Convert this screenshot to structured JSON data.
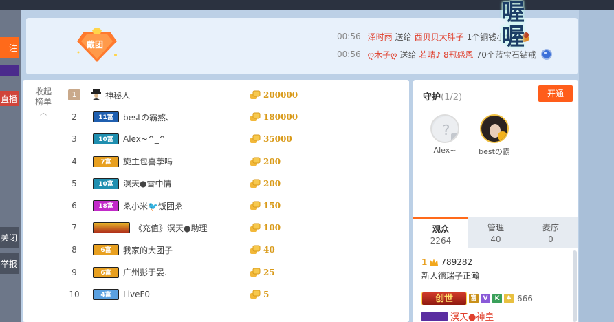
{
  "left_strip": {
    "orange_label": "注",
    "red_label": "直播",
    "dark1_label": "关闭",
    "dark2_label": "举报"
  },
  "banner": {
    "badge_label": "戴团",
    "feed": [
      {
        "time": "00:56",
        "sender": "泽时雨",
        "action": "送给",
        "receiver": "西贝贝大胖子",
        "gift": "1个铜钱小伙"
      },
      {
        "time": "00:56",
        "sender": "ღ木子ღ",
        "action": "送给",
        "receiver": "若晴♪ 8冠感恩",
        "gift": "70个蓝宝石钻戒"
      }
    ],
    "overlay_text": "喔喔"
  },
  "rank": {
    "collapse_label": "收起榜单",
    "collapse_arrow": "︿",
    "rows": [
      {
        "rank": "1",
        "badge": "",
        "name": "神秘人",
        "score": "200000",
        "color": "#000000"
      },
      {
        "rank": "2",
        "badge": "11富",
        "name": "bestの霸熬、",
        "score": "180000",
        "color": "#1f5fb0"
      },
      {
        "rank": "3",
        "badge": "10富",
        "name": "Alex~^_^",
        "score": "35000",
        "color": "#1f8fb0"
      },
      {
        "rank": "4",
        "badge": "7富",
        "name": "旋主包喜荸吗",
        "score": "200",
        "color": "#e8a020"
      },
      {
        "rank": "5",
        "badge": "10富",
        "name": "溟天●雪中情",
        "score": "200",
        "color": "#1f8fb0"
      },
      {
        "rank": "6",
        "badge": "18富",
        "name": "ゑ小米🐦饭团ゑ",
        "score": "150",
        "color": "#c22ac9"
      },
      {
        "rank": "7",
        "badge": "",
        "name": "《充值》溟天●助理",
        "score": "100",
        "color": "#c0301a"
      },
      {
        "rank": "8",
        "badge": "6富",
        "name": "我家的大团子",
        "score": "40",
        "color": "#e8a020"
      },
      {
        "rank": "9",
        "badge": "6富",
        "name": "广州彭于晏.",
        "score": "25",
        "color": "#e8a020"
      },
      {
        "rank": "10",
        "badge": "4富",
        "name": "LiveF0",
        "score": "5",
        "color": "#5aa0e0"
      }
    ]
  },
  "guard": {
    "title": "守护",
    "count": "(1/2)",
    "open_label": "开通",
    "members": [
      {
        "name": "Alex~"
      },
      {
        "name": "bestの霸"
      }
    ]
  },
  "audience": {
    "tabs": [
      {
        "label": "观众",
        "count": "2264"
      },
      {
        "label": "管理",
        "count": "40"
      },
      {
        "label": "麦序",
        "count": "0"
      }
    ],
    "entry1_level": "1",
    "entry1_id": "789282",
    "entry1_name": "新人德瑞子正瀚",
    "entry2_title": "创世",
    "entry2_badges": [
      "富",
      "V",
      "K",
      "♣"
    ],
    "entry2_id": "666",
    "entry3_name": "溟天●神皇"
  }
}
